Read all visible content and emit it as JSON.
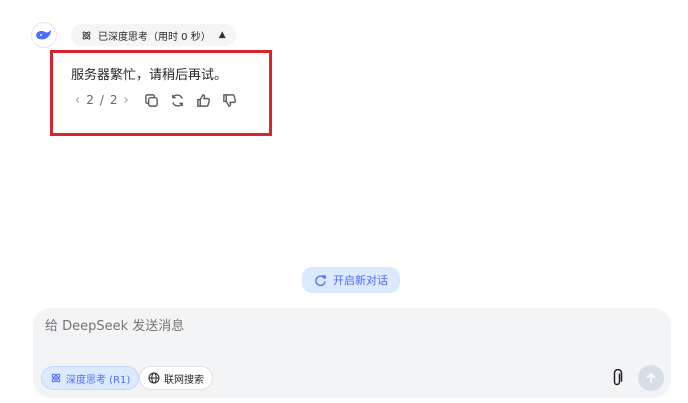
{
  "thinking": {
    "label": "已深度思考（用时 0 秒）",
    "icon": "atom-icon",
    "toggle_icon": "chevron-up-icon"
  },
  "message": {
    "text": "服务器繁忙，请稍后再试。",
    "pager": {
      "prev": "‹",
      "current": "2",
      "separator": "/",
      "total": "2",
      "next": "›"
    },
    "actions": [
      "copy-icon",
      "regenerate-icon",
      "thumbs-up-icon",
      "thumbs-down-icon"
    ]
  },
  "new_chat": {
    "label": "开启新对话",
    "icon": "refresh-chat-icon"
  },
  "composer": {
    "placeholder": "给 DeepSeek 发送消息",
    "deep_think_label": "深度思考 (R1)",
    "web_search_label": "联网搜索",
    "attach_icon": "paperclip-icon",
    "send_icon": "arrow-up-icon"
  },
  "colors": {
    "accent": "#4d6bfe",
    "accent_bg": "#dbeafe",
    "highlight": "#d6252c",
    "composer_bg": "#f3f4f6"
  }
}
